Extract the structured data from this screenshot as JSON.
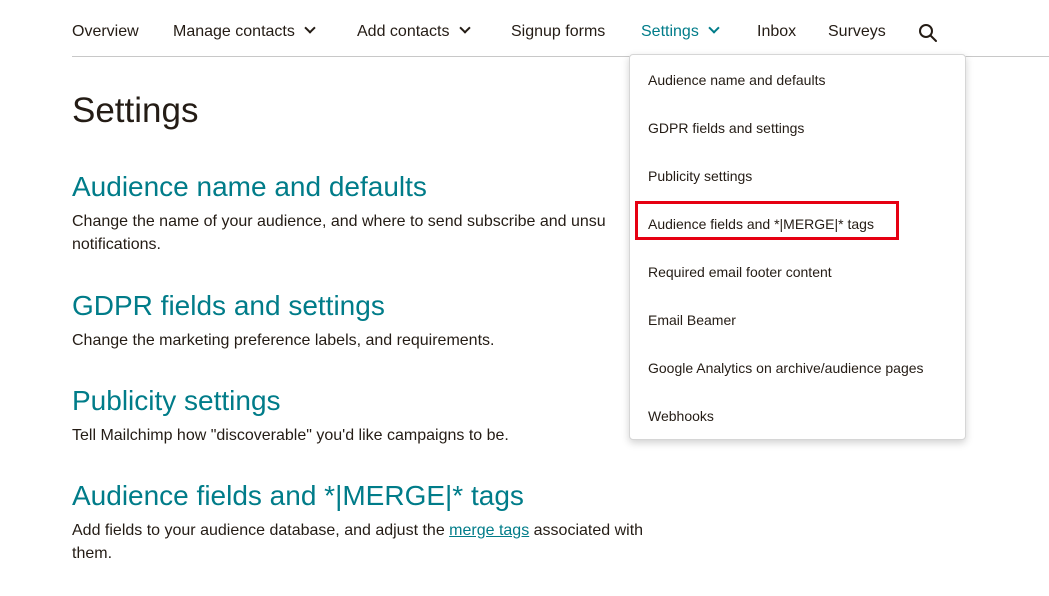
{
  "nav": {
    "overview": "Overview",
    "manage_contacts": "Manage contacts",
    "add_contacts": "Add contacts",
    "signup_forms": "Signup forms",
    "settings": "Settings",
    "inbox": "Inbox",
    "surveys": "Surveys",
    "search_icon": "search-icon",
    "active_color": "#007c89"
  },
  "main": {
    "title": "Settings",
    "sections": [
      {
        "heading": "Audience name and defaults",
        "desc_line1": "Change the name of your audience, and where to send subscribe and unsu",
        "desc_line2": "notifications."
      },
      {
        "heading": "GDPR fields and settings",
        "desc_line1": "Change the marketing preference labels, and requirements."
      },
      {
        "heading": "Publicity settings",
        "desc_line1": "Tell Mailchimp how \"discoverable\" you'd like campaigns to be."
      },
      {
        "heading": "Audience fields and *|MERGE|* tags",
        "desc_before_link": "Add fields to your audience database, and adjust the ",
        "desc_link": "merge tags",
        "desc_after_link": " associated with",
        "desc_line2": "them."
      }
    ],
    "heading_color": "#007c89"
  },
  "dropdown": {
    "items": [
      "Audience name and defaults",
      "GDPR fields and settings",
      "Publicity settings",
      "Audience fields and *|MERGE|* tags",
      "Required email footer content",
      "Email Beamer",
      "Google Analytics on archive/audience pages",
      "Webhooks"
    ],
    "highlight_color": "#e60012"
  }
}
